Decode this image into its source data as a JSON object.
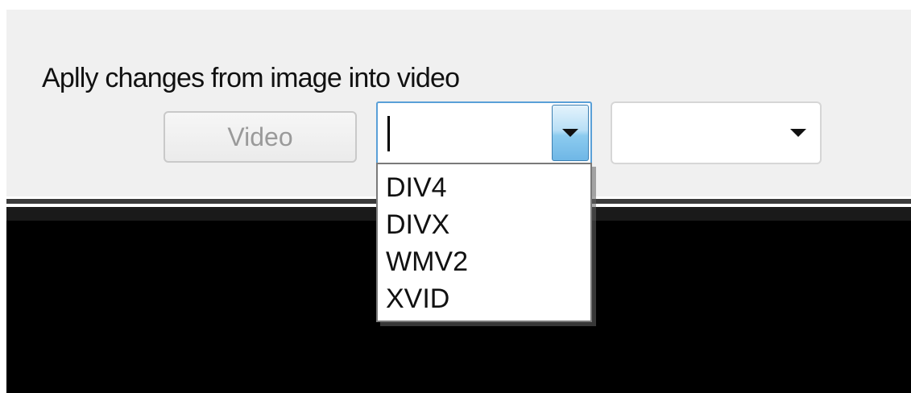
{
  "panel": {
    "label": "Aplly changes from image into video"
  },
  "controls": {
    "video_button_label": "Video",
    "codec_combo": {
      "value": "",
      "expanded": true,
      "options": [
        "DIV4",
        "DIVX",
        "WMV2",
        "XVID"
      ]
    },
    "second_combo": {
      "value": ""
    }
  },
  "icons": {
    "dropdown_arrow": "chevron-down-icon"
  },
  "colors": {
    "focus_border": "#5aa0d8",
    "video_area": "#000000",
    "panel_background": "#f0f0f0"
  }
}
